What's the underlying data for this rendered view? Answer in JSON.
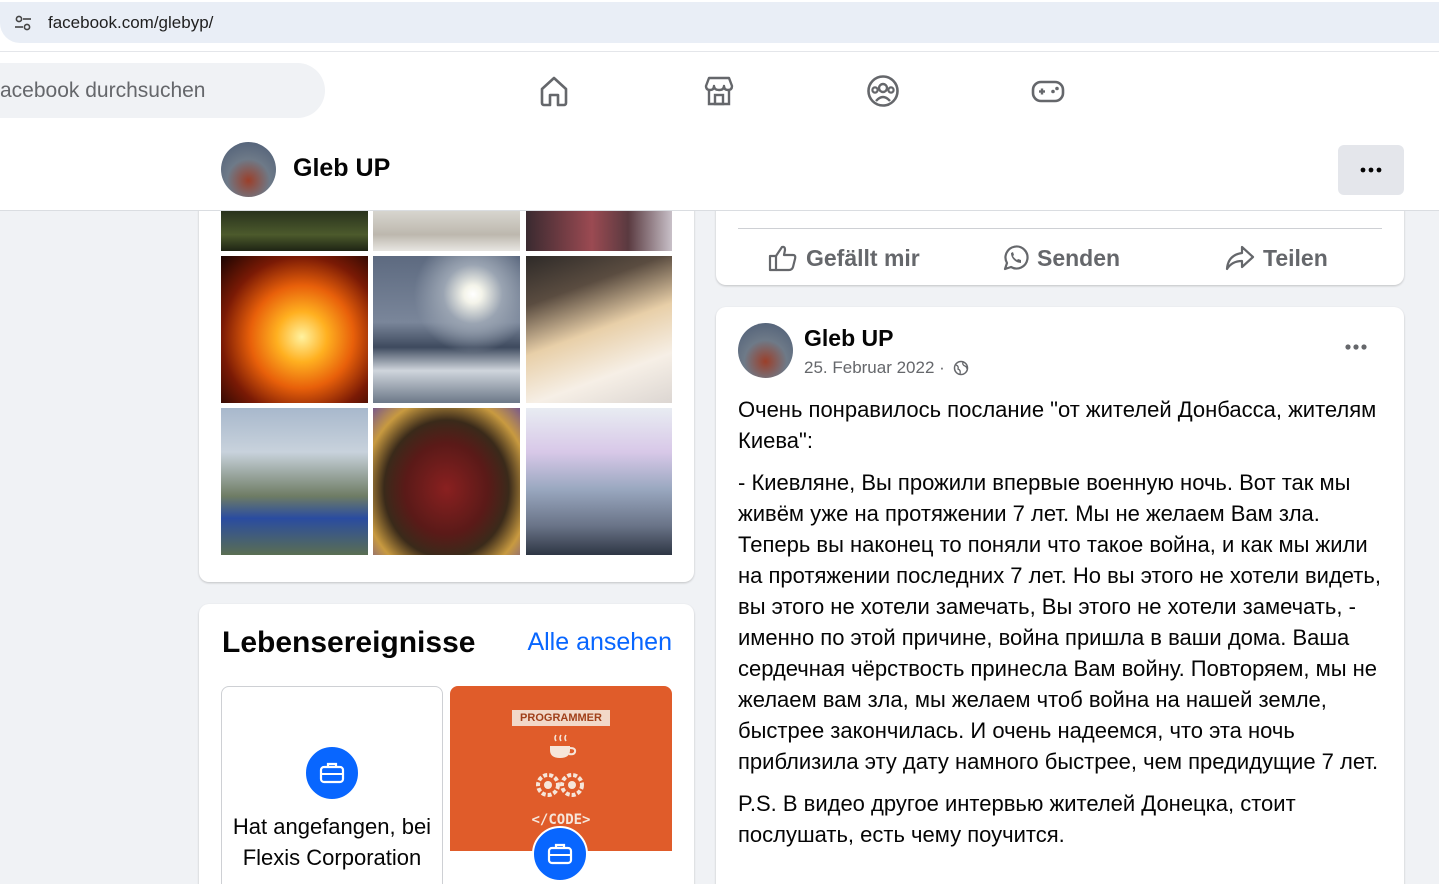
{
  "browser": {
    "url": "facebook.com/glebyp/"
  },
  "nav": {
    "search_placeholder": "acebook durchsuchen"
  },
  "profile": {
    "name": "Gleb UP",
    "more_label": "..."
  },
  "events": {
    "title": "Lebensereignisse",
    "see_all": "Alle ansehen",
    "card1_text": "Hat angefangen, bei Flexis Corporation",
    "card2_banner": "PROGRAMMER",
    "card2_code": "</CODE>"
  },
  "actions": {
    "like": "Gefällt mir",
    "send": "Senden",
    "share": "Teilen"
  },
  "post": {
    "author": "Gleb UP",
    "date": "25. Februar 2022 ·",
    "paragraphs": [
      "Очень понравилось послание \"от жителей Донбасса, жителям Киева\":",
      "- Киевляне, Вы прожили впервые военную ночь. Вот так мы живём уже на протяжении 7 лет. Мы не желаем Вам зла. Теперь вы наконец то поняли что такое война, и как мы жили на протяжении последних 7 лет. Но вы этого не хотели видеть, вы этого не хотели замечать, Вы этого не хотели замечать, - именно по этой причине, война пришла в ваши дома. Ваша сердечная чёрствость принесла Вам войну. Повторяем, мы не желаем вам зла, мы желаем чтоб война на нашей земле, быстрее закончилась. И очень надеемся, что эта ночь приблизила эту дату намного быстрее, чем предидущие 7 лет.",
      "P.S. В видео другое интервью жителей Донецка, стоит послушать, есть чему поучится."
    ]
  },
  "colors": {
    "fb_blue": "#0866ff",
    "muted": "#65676b",
    "page_bg": "#f0f2f5"
  }
}
